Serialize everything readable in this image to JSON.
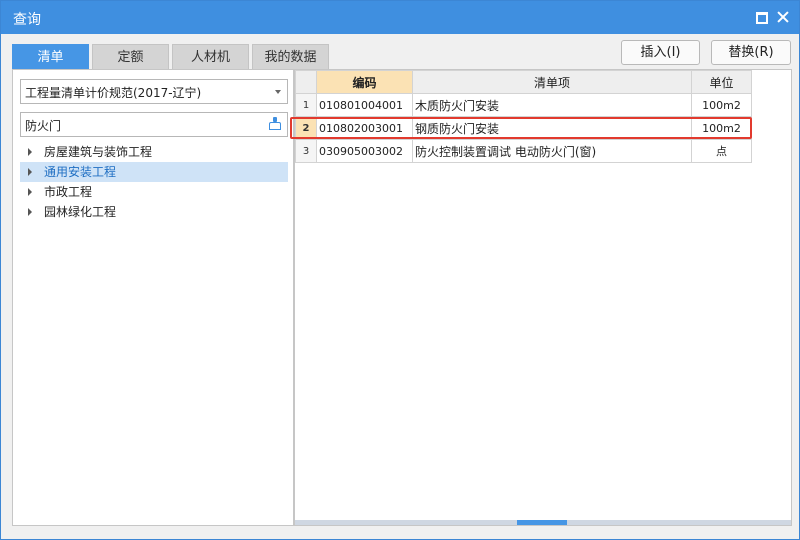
{
  "window": {
    "title": "查询"
  },
  "tabs": [
    {
      "label": "清单",
      "active": true
    },
    {
      "label": "定额",
      "active": false
    },
    {
      "label": "人材机",
      "active": false
    },
    {
      "label": "我的数据",
      "active": false
    }
  ],
  "actions": {
    "insert_label": "插入(I)",
    "replace_label": "替换(R)"
  },
  "left": {
    "spec_selected": "工程量清单计价规范(2017-辽宁)",
    "search_value": "防火门",
    "tree": [
      {
        "label": "房屋建筑与装饰工程",
        "selected": false
      },
      {
        "label": "通用安装工程",
        "selected": true
      },
      {
        "label": "市政工程",
        "selected": false
      },
      {
        "label": "园林绿化工程",
        "selected": false
      }
    ]
  },
  "grid": {
    "columns": {
      "code": "编码",
      "item": "清单项",
      "unit": "单位"
    },
    "rows": [
      {
        "num": "1",
        "code": "010801004001",
        "name": "木质防火门安装",
        "unit": "100m2"
      },
      {
        "num": "2",
        "code": "010802003001",
        "name": "钢质防火门安装",
        "unit": "100m2"
      },
      {
        "num": "3",
        "code": "030905003002",
        "name": "防火控制装置调试 电动防火门(窗)",
        "unit": "点"
      }
    ],
    "current_row": 2
  },
  "colors": {
    "accent": "#3f8fe0",
    "highlight_border": "#e23a2e",
    "header_highlight": "#fbe2b4"
  }
}
